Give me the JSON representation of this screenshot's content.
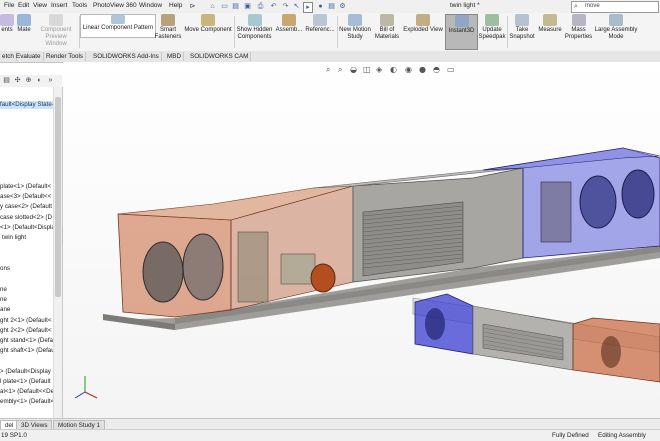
{
  "menu": {
    "items": [
      "File",
      "Edit",
      "View",
      "Insert",
      "Tools",
      "PhotoView 360",
      "Window",
      "Help"
    ],
    "pin_glyph": "⊳"
  },
  "document_title": "twin light *",
  "search": {
    "value": "move"
  },
  "commands": [
    {
      "label": "ents",
      "icon": "assembly-icon"
    },
    {
      "label": "Mate",
      "icon": "mate-icon"
    },
    {
      "label": "Component Preview Window",
      "icon": "preview-window-icon",
      "disabled": true
    },
    {
      "label": "Linear Component Pattern",
      "icon": "linear-pattern-icon"
    },
    {
      "label": "Smart Fasteners",
      "icon": "smart-fasteners-icon"
    },
    {
      "label": "Move Component",
      "icon": "move-component-icon"
    },
    {
      "label": "Show Hidden Components",
      "icon": "show-hidden-icon"
    },
    {
      "label": "Assemb...",
      "icon": "assembly-features-icon"
    },
    {
      "label": "Referenc...",
      "icon": "reference-geometry-icon"
    },
    {
      "label": "New Motion Study",
      "icon": "motion-study-icon"
    },
    {
      "label": "Bill of Materials",
      "icon": "bom-icon"
    },
    {
      "label": "Exploded View",
      "icon": "exploded-view-icon"
    },
    {
      "label": "Instant3D",
      "icon": "instant3d-icon",
      "active": true
    },
    {
      "label": "Update Speedpak",
      "icon": "speedpak-icon"
    },
    {
      "label": "Take Snapshot",
      "icon": "snapshot-icon"
    },
    {
      "label": "Measure",
      "icon": "measure-icon"
    },
    {
      "label": "Mass Properties",
      "icon": "mass-properties-icon"
    },
    {
      "label": "Large Assembly Mode",
      "icon": "large-assembly-icon"
    }
  ],
  "tabs": [
    "etch",
    "Evaluate",
    "Render Tools",
    "SOLIDWORKS Add-Ins",
    "MBD",
    "SOLIDWORKS CAM"
  ],
  "tree": {
    "selected": "fault<Display State-",
    "rows": [
      "plate<1> (Default<",
      "ase<3> (Default<<",
      "y case<2> (Default",
      "case slotted<2> (D",
      "<1> (Default<Display",
      "twin light",
      "ons",
      "ne",
      "ne",
      "ane",
      "ght 2<1> (Default<",
      "ght 2<2> (Default<",
      "ght stand<1> (Defau",
      "ght shaft<1> (Defau",
      "> (Default<Display",
      "l plate<1> (Default",
      "al<1> (Default<<De",
      "embly<1> (Default<"
    ]
  },
  "bottom_tabs": [
    "del",
    "3D Views",
    "Motion Study 1"
  ],
  "status": {
    "left": "19 SP1.0",
    "middle": "Fully Defined",
    "right": "Editing Assembly"
  },
  "colors": {
    "highlight": "#cfe3f8",
    "transparent_orange": "#c8643a",
    "transparent_blue": "#4c50d8",
    "housing_grey": "#a8a6a3"
  }
}
